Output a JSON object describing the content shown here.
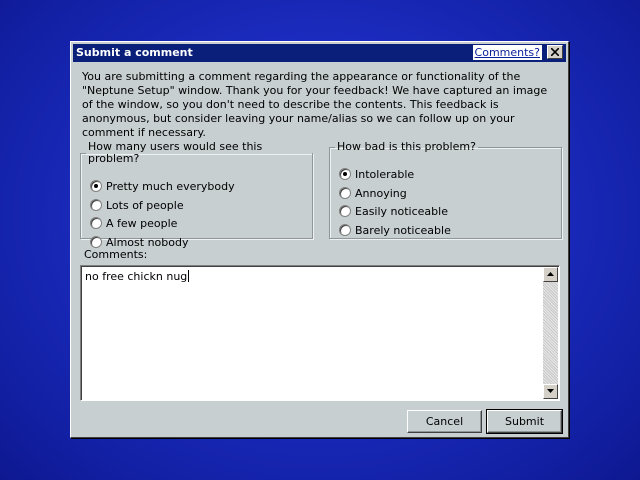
{
  "dialog": {
    "title": "Submit a comment",
    "help_link": "Comments?",
    "intro": "You are submitting a comment regarding the appearance or functionality of the \"Neptune Setup\" window. Thank you for your feedback! We have captured an image of the window, so you don't need to describe the contents. This feedback is anonymous, but consider leaving your name/alias so we can follow up on your comment if necessary."
  },
  "users_group": {
    "legend": "How many users would see this problem?",
    "options": [
      {
        "label": "Pretty much everybody",
        "checked": true
      },
      {
        "label": "Lots of people",
        "checked": false
      },
      {
        "label": "A few people",
        "checked": false
      },
      {
        "label": "Almost nobody",
        "checked": false
      }
    ]
  },
  "severity_group": {
    "legend": "How bad is this problem?",
    "options": [
      {
        "label": "Intolerable",
        "checked": true
      },
      {
        "label": "Annoying",
        "checked": false
      },
      {
        "label": "Easily noticeable",
        "checked": false
      },
      {
        "label": "Barely noticeable",
        "checked": false
      }
    ]
  },
  "comments": {
    "label": "Comments:",
    "value": "no free chickn nug"
  },
  "buttons": {
    "cancel": "Cancel",
    "submit": "Submit"
  },
  "icons": {
    "close": "close-icon",
    "scroll_up": "scroll-up-arrow-icon",
    "scroll_down": "scroll-down-arrow-icon"
  }
}
